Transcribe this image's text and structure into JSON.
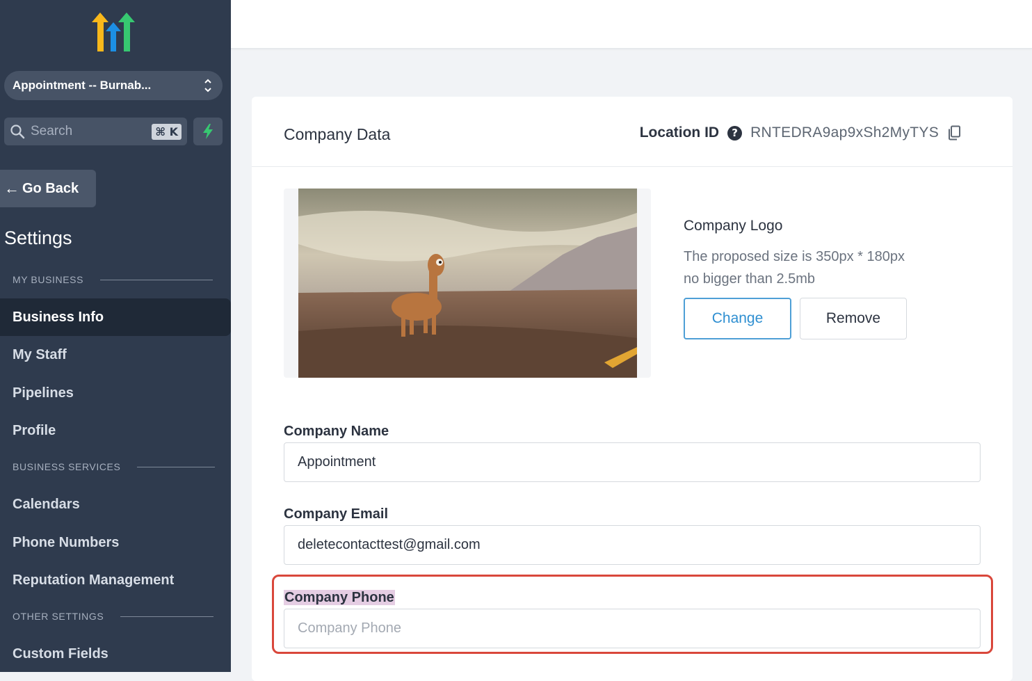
{
  "sidebar": {
    "location_switcher": "Appointment -- Burnab...",
    "search": {
      "placeholder": "Search",
      "shortcut": "⌘ K"
    },
    "go_back": "Go Back",
    "settings_title": "Settings",
    "sections": {
      "my_business": "MY BUSINESS",
      "business_services": "BUSINESS SERVICES",
      "other_settings": "OTHER SETTINGS"
    },
    "items": [
      {
        "label": "Business Info",
        "active": true
      },
      {
        "label": "My Staff"
      },
      {
        "label": "Pipelines"
      },
      {
        "label": "Profile"
      },
      {
        "label": "Calendars"
      },
      {
        "label": "Phone Numbers"
      },
      {
        "label": "Reputation Management"
      },
      {
        "label": "Custom Fields"
      }
    ]
  },
  "card": {
    "title": "Company Data",
    "location_id_label": "Location ID",
    "location_id_value": "RNTEDRA9ap9xSh2MyTYS",
    "logo": {
      "title": "Company Logo",
      "hint_line1": "The proposed size is 350px * 180px",
      "hint_line2": "no bigger than 2.5mb",
      "change_label": "Change",
      "remove_label": "Remove"
    },
    "fields": {
      "company_name": {
        "label": "Company Name",
        "value": "Appointment"
      },
      "company_email": {
        "label": "Company Email",
        "value": "deletecontacttest@gmail.com"
      },
      "company_phone": {
        "label": "Company Phone",
        "value": "",
        "placeholder": "Company Phone"
      }
    }
  },
  "colors": {
    "sidebar_bg": "#2f3b4e",
    "accent_blue": "#2f8fd1",
    "highlight_red": "#d9473b",
    "bolt_green": "#37c871"
  }
}
